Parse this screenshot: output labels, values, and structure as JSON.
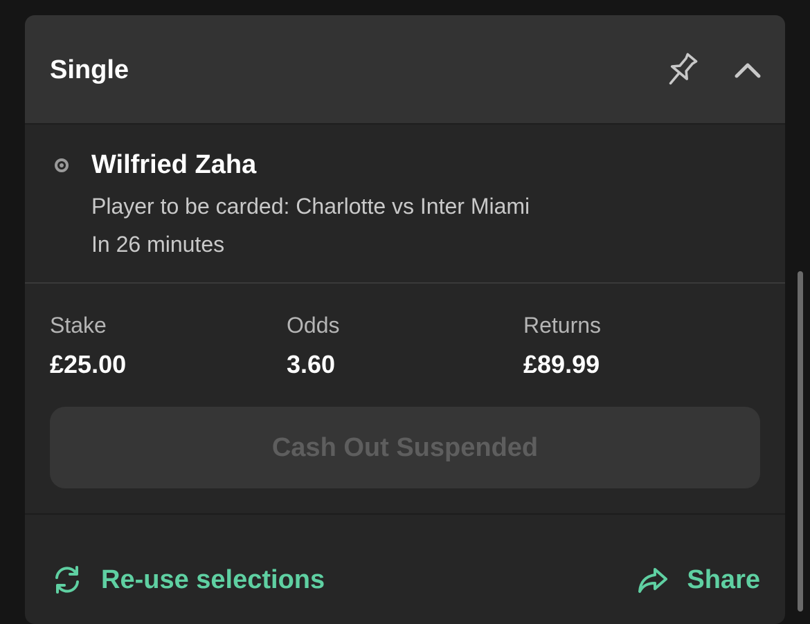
{
  "bet": {
    "type_label": "Single",
    "selection": {
      "name": "Wilfried Zaha",
      "market": "Player to be carded: Charlotte vs Inter Miami",
      "start_time": "In 26 minutes"
    },
    "stake": {
      "label": "Stake",
      "value": "£25.00"
    },
    "odds": {
      "label": "Odds",
      "value": "3.60"
    },
    "returns": {
      "label": "Returns",
      "value": "£89.99"
    },
    "cashout_label": "Cash Out Suspended"
  },
  "actions": {
    "reuse_label": "Re-use selections",
    "share_label": "Share"
  },
  "icons": {
    "pin": "pin-icon",
    "collapse": "chevron-up-icon",
    "status": "radio-dot-icon",
    "reuse": "refresh-icon",
    "share": "share-arrow-icon"
  },
  "colors": {
    "accent": "#5fd0a2",
    "card_bg": "#262626",
    "header_bg": "#333333",
    "disabled_text": "#5e5e5e"
  }
}
